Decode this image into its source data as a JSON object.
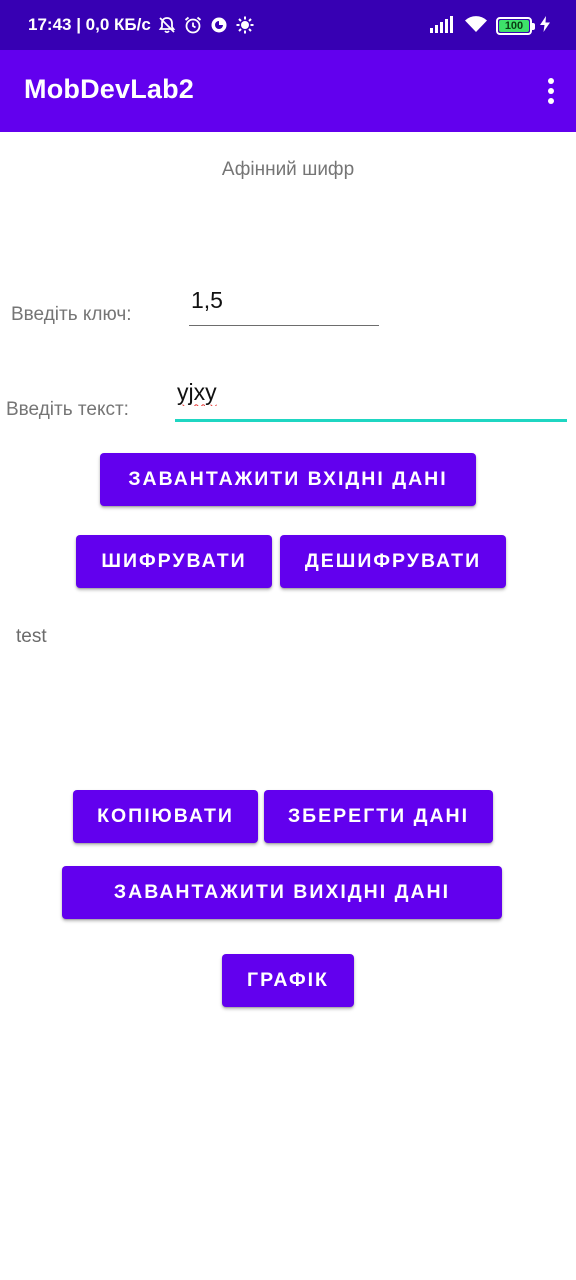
{
  "status_bar": {
    "time_speed": "17:43 | 0,0 КБ/с",
    "battery_level": "100",
    "icons": [
      "muted-bell-icon",
      "alarm-icon",
      "data-saver-icon",
      "brightness-icon",
      "signal-icon",
      "wifi-icon",
      "battery-icon",
      "charging-icon"
    ]
  },
  "app_bar": {
    "title": "MobDevLab2",
    "menu_icon": "overflow-menu-icon"
  },
  "main": {
    "cipher_title": "Афінний шифр",
    "key_label": "Введіть ключ:",
    "key_value": "1,5",
    "text_label": "Введіть текст:",
    "text_value": "yjxy",
    "load_input_label": "ЗАВАНТАЖИТИ ВХІДНІ ДАНІ",
    "encrypt_label": "ШИФРУВАТИ",
    "decrypt_label": "ДЕШИФРУВАТИ",
    "output_text": "test",
    "copy_label": "КОПІЮВАТИ",
    "save_label": "ЗБЕРЕГТИ ДАНІ",
    "load_output_label": "ЗАВАНТАЖИТИ ВИХІДНІ ДАНІ",
    "chart_label": "ГРАФІК"
  },
  "colors": {
    "status_bar": "#3700b3",
    "primary": "#6200ee",
    "focus_underline": "#1fd6c2",
    "spellcheck": "#e53935"
  }
}
